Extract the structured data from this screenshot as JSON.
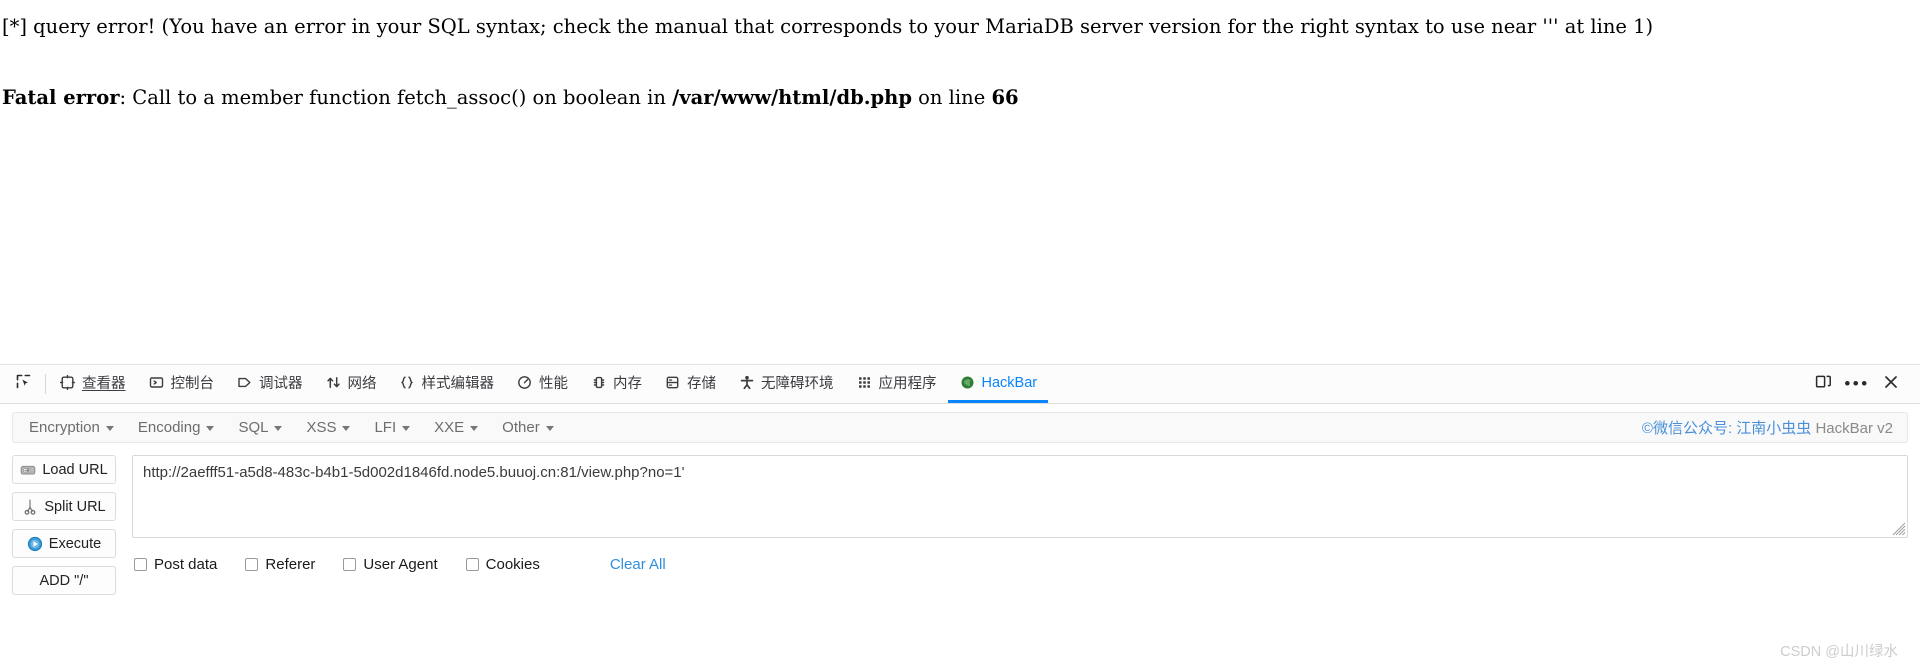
{
  "page": {
    "query_error": "[*] query error! (You have an error in your SQL syntax; check the manual that corresponds to your MariaDB server version for the right syntax to use near ''' at line 1)",
    "fatal_label": "Fatal error",
    "fatal_mid": ": Call to a member function fetch_assoc() on boolean in ",
    "fatal_file": "/var/www/html/db.php",
    "fatal_on_line": " on line ",
    "fatal_line_no": "66"
  },
  "devtools": {
    "picker_icon": "element-picker-icon",
    "tabs": [
      {
        "label": "查看器",
        "icon": "inspector-icon",
        "active": false,
        "underlined": true
      },
      {
        "label": "控制台",
        "icon": "console-icon",
        "active": false,
        "underlined": false
      },
      {
        "label": "调试器",
        "icon": "debugger-icon",
        "active": false,
        "underlined": false
      },
      {
        "label": "网络",
        "icon": "network-icon",
        "active": false,
        "underlined": false
      },
      {
        "label": "样式编辑器",
        "icon": "style-editor-icon",
        "active": false,
        "underlined": false
      },
      {
        "label": "性能",
        "icon": "performance-icon",
        "active": false,
        "underlined": false
      },
      {
        "label": "内存",
        "icon": "memory-icon",
        "active": false,
        "underlined": false
      },
      {
        "label": "存储",
        "icon": "storage-icon",
        "active": false,
        "underlined": false
      },
      {
        "label": "无障碍环境",
        "icon": "accessibility-icon",
        "active": false,
        "underlined": false
      },
      {
        "label": "应用程序",
        "icon": "application-icon",
        "active": false,
        "underlined": false
      },
      {
        "label": "HackBar",
        "icon": "hackbar-icon",
        "active": true,
        "underlined": false
      }
    ],
    "active_tab_color": "#0a84ff",
    "right_buttons": [
      {
        "name": "responsive-design-mode-icon"
      },
      {
        "name": "devtools-meatball-menu-icon"
      },
      {
        "name": "devtools-close-icon"
      }
    ]
  },
  "hackbar": {
    "menus": [
      {
        "label": "Encryption"
      },
      {
        "label": "Encoding"
      },
      {
        "label": "SQL"
      },
      {
        "label": "XSS"
      },
      {
        "label": "LFI"
      },
      {
        "label": "XXE"
      },
      {
        "label": "Other"
      }
    ],
    "brand_blue": "©微信公众号: 江南小虫虫",
    "brand_gray": " HackBar v2",
    "buttons": [
      {
        "label": "Load URL",
        "icon": "load-url-icon"
      },
      {
        "label": "Split URL",
        "icon": "scissors-icon"
      },
      {
        "label": "Execute",
        "icon": "play-icon"
      },
      {
        "label": "ADD \"/\"",
        "icon": "none"
      }
    ],
    "url_value": "http://2aefff51-a5d8-483c-b4b1-5d002d1846fd.node5.buuoj.cn:81/view.php?no=1'",
    "url_placeholder": "",
    "checkboxes": [
      {
        "label": "Post data",
        "checked": false
      },
      {
        "label": "Referer",
        "checked": false
      },
      {
        "label": "User Agent",
        "checked": false
      },
      {
        "label": "Cookies",
        "checked": false
      }
    ],
    "clear_all_label": "Clear All",
    "link_color": "#2f8fdd"
  },
  "watermark": "CSDN @山川绿水"
}
